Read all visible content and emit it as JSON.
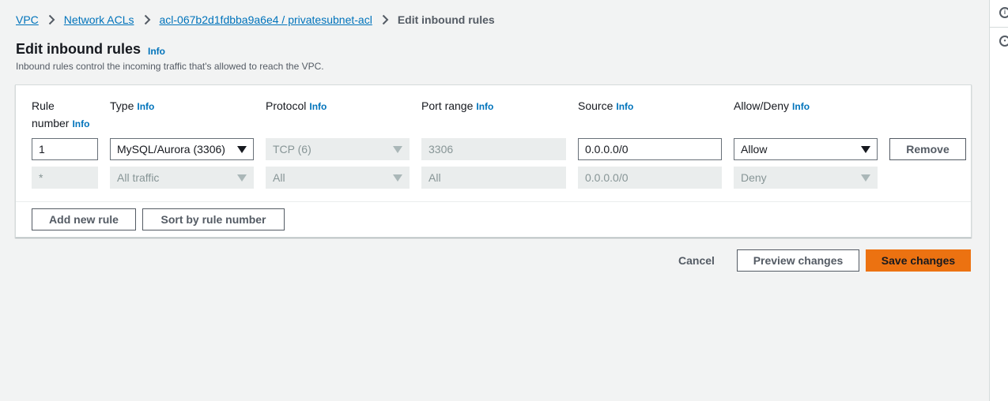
{
  "breadcrumb": {
    "items": [
      "VPC",
      "Network ACLs",
      "acl-067b2d1fdbba9a6e4 / privatesubnet-acl"
    ],
    "current": "Edit inbound rules"
  },
  "page": {
    "title": "Edit inbound rules",
    "info": "Info",
    "description": "Inbound rules control the incoming traffic that's allowed to reach the VPC."
  },
  "columns": {
    "rule_number_line1": "Rule",
    "rule_number_line2": "number",
    "type": "Type",
    "protocol": "Protocol",
    "port_range": "Port range",
    "source": "Source",
    "allow_deny": "Allow/Deny",
    "info": "Info"
  },
  "rules": [
    {
      "rule_number": "1",
      "type": "MySQL/Aurora (3306)",
      "protocol": "TCP (6)",
      "port_range": "3306",
      "source": "0.0.0.0/0",
      "allow_deny": "Allow",
      "remove_label": "Remove"
    },
    {
      "rule_number": "*",
      "type": "All traffic",
      "protocol": "All",
      "port_range": "All",
      "source": "0.0.0.0/0",
      "allow_deny": "Deny"
    }
  ],
  "panel_buttons": {
    "add_rule": "Add new rule",
    "sort": "Sort by rule number"
  },
  "footer": {
    "cancel": "Cancel",
    "preview": "Preview changes",
    "save": "Save changes"
  },
  "colors": {
    "link": "#0073bb",
    "primary": "#ec7211",
    "background": "#f2f3f3"
  },
  "right_rail": {
    "icons": [
      "info-circle-icon",
      "settings-hex-icon"
    ]
  }
}
